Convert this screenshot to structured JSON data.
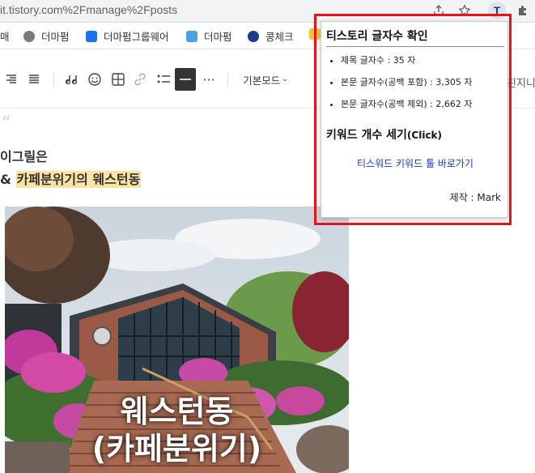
{
  "browser": {
    "url": "it.tistory.com%2Fmanage%2Fposts",
    "icons": [
      "share-icon",
      "star-icon",
      "extension-puzzle-icon"
    ],
    "extension_label": "T"
  },
  "bookmarks": [
    {
      "label": "매",
      "color": "#ffffff"
    },
    {
      "label": "더마펌",
      "color": "#7a7a7a"
    },
    {
      "label": "더마펌그룹웨어",
      "color": "#1a73e8"
    },
    {
      "label": "더마펌",
      "color": "#4aa3df"
    },
    {
      "label": "콩체크",
      "color": "#1b3a8c"
    }
  ],
  "toolbar": {
    "mode_label": "기본모드",
    "right_text": "친지니"
  },
  "content": {
    "quote_mark": "“",
    "line1": "이그릴은",
    "line2_prefix": "& ",
    "line2_highlight": "카페분위기의 웨스턴동",
    "photo_caption_1": "웨스턴동",
    "photo_caption_2": "(카페분위기)"
  },
  "popup": {
    "title": "티스토리 글자수 확인",
    "stats": [
      "제목 글자수 : 35 자",
      "본문 글자수(공백 포함) : 3,305 자",
      "본문 글자수(공백 제외) : 2,662 자"
    ],
    "keyword_title": "키워드 개수 세기",
    "keyword_title_suffix": "(Click)",
    "keyword_link": "티스워드 키워드 툴 바로가기",
    "maker": "제작 : Mark"
  },
  "colors": {
    "highlight_box": "#e5141b",
    "link": "#1a33c9",
    "text_highlight": "#fbe3a4"
  }
}
